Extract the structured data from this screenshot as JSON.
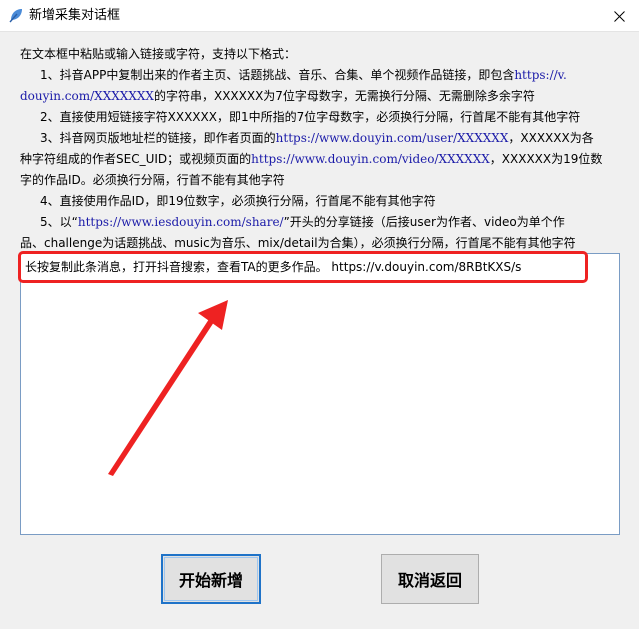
{
  "window": {
    "title": "新增采集对话框",
    "app_icon": "leaf-icon",
    "close_icon": "close-icon"
  },
  "instructions": {
    "intro": "在文本框中粘贴或输入链接或字符，支持以下格式：",
    "item1": {
      "p1": "1、抖音APP中复制出来的作者主页、话题挑战、音乐、合集、单个视频作品链接，即包含",
      "url1": "https://v.",
      "url2": "douyin.com/XXXXXXX",
      "p2": "的字符串，XXXXXX为7位字母数字，无需换行分隔、无需删除多余字符"
    },
    "item2": "2、直接使用短链接字符XXXXXX，即1中所指的7位字母数字，必须换行分隔，行首尾不能有其他字符",
    "item3": {
      "p1": "3、抖音网页版地址栏的链接，即作者页面的",
      "url1": "https://www.douyin.com/user/XXXXXX",
      "p2": "，XXXXXX为各",
      "p3": "种字符组成的作者SEC_UID；或视频页面的",
      "url2": "https://www.douyin.com/video/XXXXXX",
      "p4": "，XXXXXX为19位数",
      "p5": "字的作品ID。必须换行分隔，行首不能有其他字符"
    },
    "item4": "4、直接使用作品ID，即19位数字，必须换行分隔，行首尾不能有其他字符",
    "item5": {
      "p1": "5、以“",
      "url": "https://www.iesdouyin.com/share/",
      "p2": "”开头的分享链接（后接user为作者、video为单个作",
      "p3": "品、challenge为话题挑战、music为音乐、mix/detail为合集），必须换行分隔，行首尾不能有其他字符"
    }
  },
  "input": {
    "value": "长按复制此条消息，打开抖音搜索，查看TA的更多作品。 https://v.douyin.com/8RBtKXS/s"
  },
  "buttons": {
    "start": "开始新增",
    "cancel": "取消返回"
  },
  "annotation": {
    "box_color": "#ee2222",
    "arrow_color": "#ee2222"
  }
}
